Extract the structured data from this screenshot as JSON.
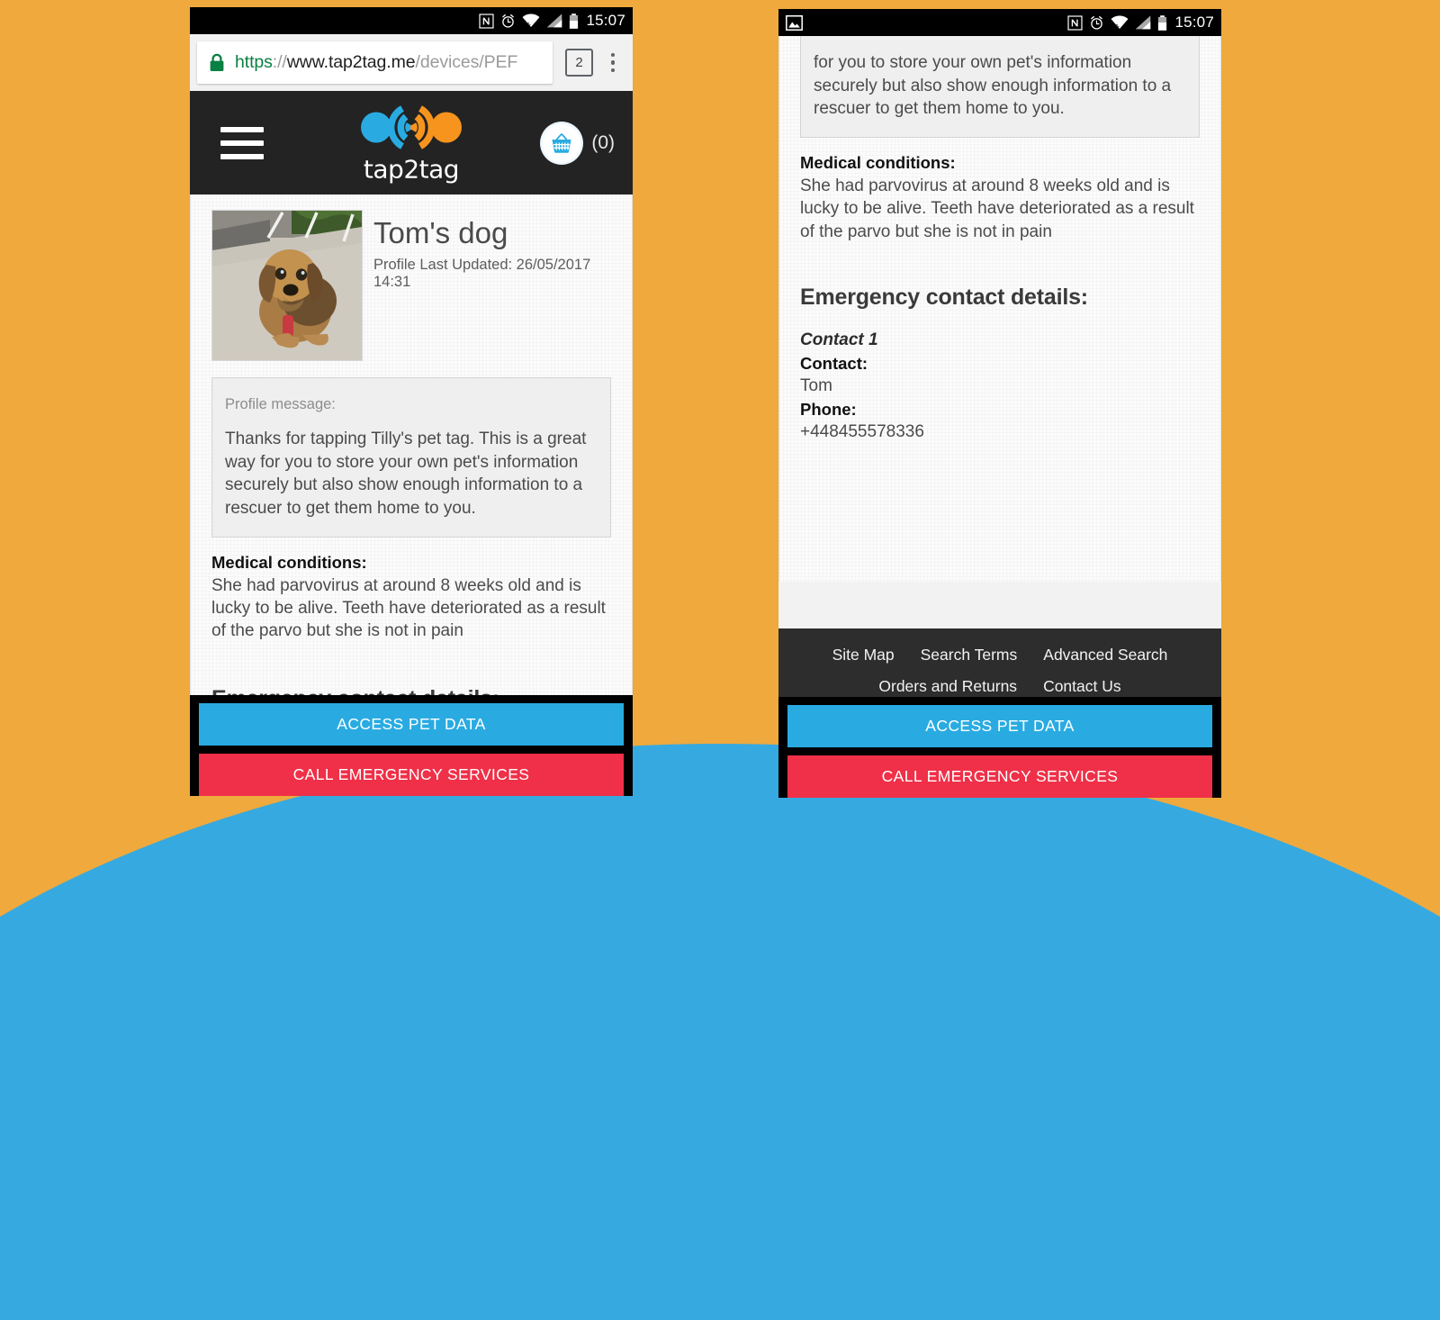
{
  "background": {
    "orange": "#efa93d",
    "blue": "#36a9e0"
  },
  "status_bar": {
    "time": "15:07",
    "icons_left_right_phone": [
      "image-icon"
    ],
    "icons": [
      "nfc-icon",
      "alarm-icon",
      "wifi-icon",
      "signal-icon",
      "battery-icon"
    ]
  },
  "browser": {
    "url_scheme": "https",
    "url_separator": "://",
    "url_host": "www.tap2tag.me",
    "url_path": "/devices/PEF",
    "tab_count": "2",
    "lock_label": "secure-lock"
  },
  "site_header": {
    "logo_text": "tap2tag",
    "cart_count": "(0)",
    "logo_blue": "#29abe2",
    "logo_orange": "#f7941e"
  },
  "pet": {
    "name": "Tom's dog",
    "last_updated": "Profile Last Updated: 26/05/2017 14:31",
    "profile_message_label": "Profile message:",
    "profile_message": "Thanks for tapping Tilly's pet tag. This is a great way for you to store your own pet's information securely but also show enough information to a rescuer to get them home to you.",
    "profile_message_partial": "for you to store your own pet's information securely but also show enough information to a rescuer to get them home to you.",
    "medical_label": "Medical conditions:",
    "medical_text": "She had parvovirus at around 8 weeks old and is lucky to be alive. Teeth have deteriorated as a result of the parvo but she is not in pain",
    "emergency_heading": "Emergency contact details:"
  },
  "contacts": [
    {
      "title": "Contact 1",
      "contact_label": "Contact:",
      "contact_value": "Tom",
      "phone_label": "Phone:",
      "phone_value": "+448455578336"
    }
  ],
  "footer": {
    "row1": [
      "Site Map",
      "Search Terms",
      "Advanced Search"
    ],
    "row2": [
      "Orders and Returns",
      "Contact Us"
    ]
  },
  "actions": {
    "access": "ACCESS PET DATA",
    "emergency": "CALL EMERGENCY SERVICES",
    "access_color": "#29abe2",
    "emergency_color": "#ef3048"
  }
}
